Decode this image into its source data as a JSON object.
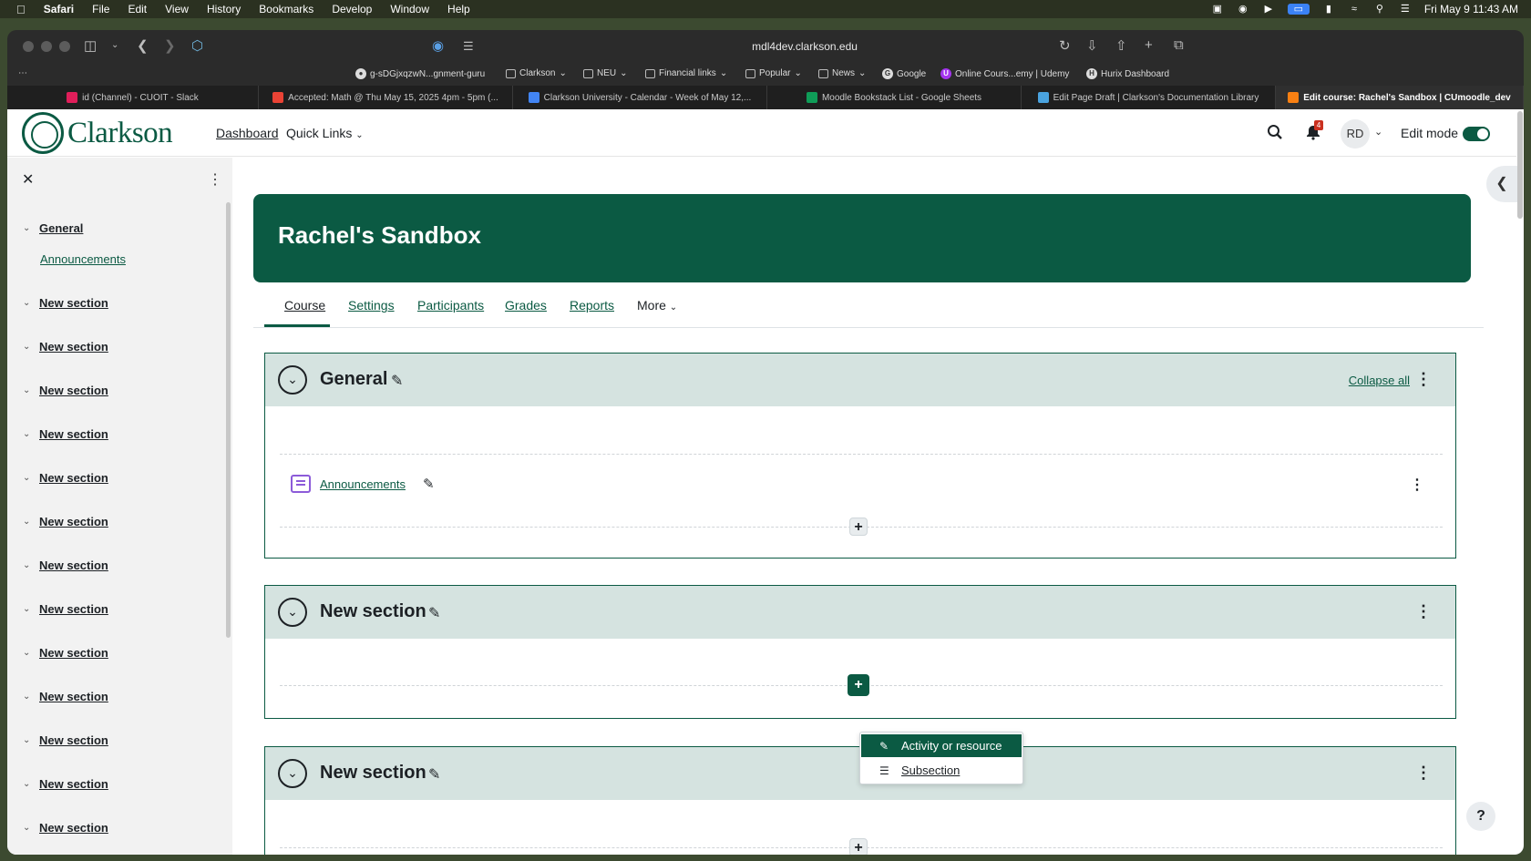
{
  "menubar": {
    "app": "Safari",
    "items": [
      "File",
      "Edit",
      "View",
      "History",
      "Bookmarks",
      "Develop",
      "Window",
      "Help"
    ],
    "clock": "Fri May 9  11:43 AM"
  },
  "browser": {
    "url": "mdl4dev.clarkson.edu",
    "bookmarks": [
      "g-sDGjxqzwN...gnment-guru",
      "Clarkson",
      "NEU",
      "Financial links",
      "Popular",
      "News",
      "Google",
      "Online Cours...emy | Udemy",
      "Hurix Dashboard"
    ],
    "tabs": [
      "id (Channel) - CUOIT - Slack",
      "Accepted: Math @ Thu May 15, 2025 4pm - 5pm (...",
      "Clarkson University - Calendar - Week of May 12,...",
      "Moodle Bookstack List - Google Sheets",
      "Edit Page Draft | Clarkson's Documentation Library",
      "Edit course: Rachel's Sandbox | CUmoodle_dev"
    ],
    "tab_colors": [
      "#e01e5a",
      "#ea4335",
      "#4285f4",
      "#0f9d58",
      "#4aa3df",
      "#f98012"
    ]
  },
  "navbar": {
    "logo_text": "Clarkson",
    "dashboard": "Dashboard",
    "quick_links": "Quick Links",
    "notifications_count": "4",
    "user_initials": "RD",
    "edit_mode_label": "Edit mode",
    "edit_mode_on": true
  },
  "drawer": {
    "general": "General",
    "announcements": "Announcements",
    "sections": [
      "New section",
      "New section",
      "New section",
      "New section",
      "New section",
      "New section",
      "New section",
      "New section",
      "New section",
      "New section",
      "New section",
      "New section",
      "New section"
    ]
  },
  "course": {
    "title": "Rachel's Sandbox",
    "tabs": [
      "Course",
      "Settings",
      "Participants",
      "Grades",
      "Reports",
      "More"
    ],
    "active_tab": "Course",
    "collapse_all": "Collapse all",
    "sections": [
      {
        "title": "General",
        "activity": "Announcements"
      },
      {
        "title": "New section"
      },
      {
        "title": "New section"
      }
    ]
  },
  "add_menu": {
    "items": [
      "Activity or resource",
      "Subsection"
    ]
  },
  "help": "?",
  "colors": {
    "brand": "#0b5a43",
    "section_header": "#d5e3e0",
    "forum_icon": "#8c5bd9"
  }
}
